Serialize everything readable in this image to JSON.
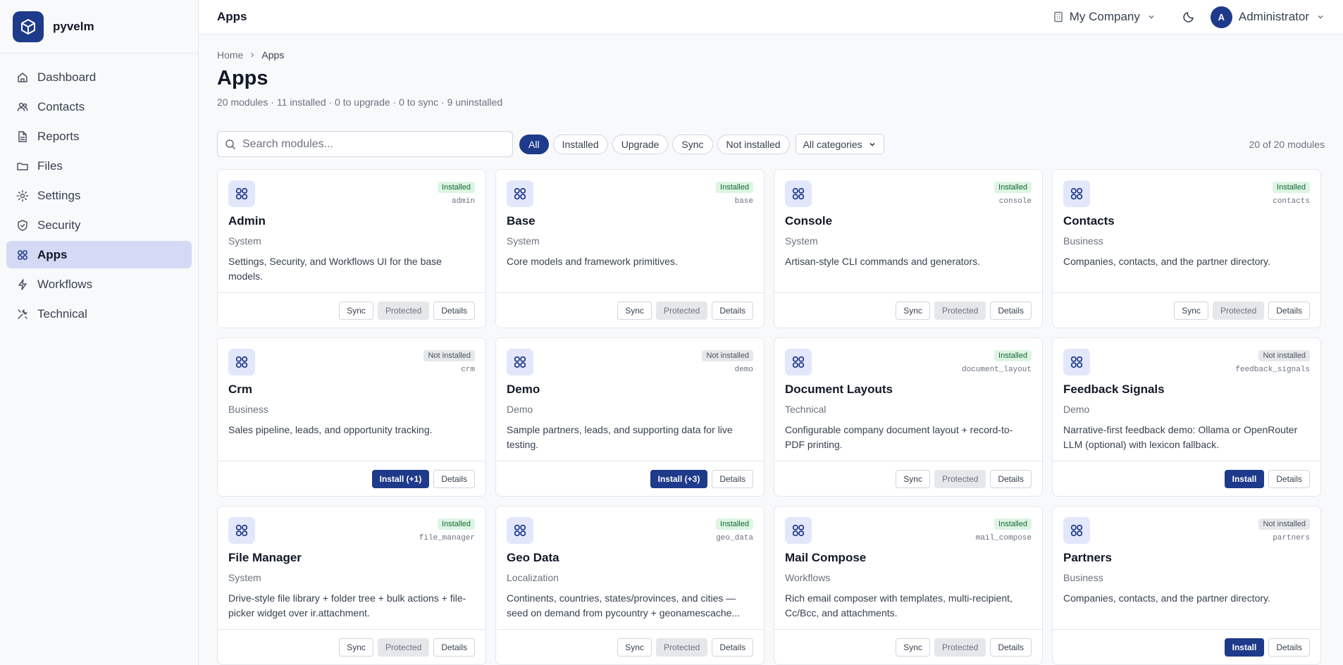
{
  "brand": {
    "name": "pyvelm"
  },
  "sidebar": {
    "items": [
      {
        "label": "Dashboard",
        "icon": "home-icon"
      },
      {
        "label": "Contacts",
        "icon": "users-icon"
      },
      {
        "label": "Reports",
        "icon": "file-icon"
      },
      {
        "label": "Files",
        "icon": "folder-icon"
      },
      {
        "label": "Settings",
        "icon": "gear-icon"
      },
      {
        "label": "Security",
        "icon": "shield-icon"
      },
      {
        "label": "Apps",
        "icon": "grid-icon",
        "active": true
      },
      {
        "label": "Workflows",
        "icon": "bolt-icon"
      },
      {
        "label": "Technical",
        "icon": "tools-icon"
      }
    ]
  },
  "topbar": {
    "title": "Apps",
    "company": "My Company",
    "avatar_initial": "A",
    "user": "Administrator"
  },
  "breadcrumb": {
    "home": "Home",
    "current": "Apps"
  },
  "page": {
    "title": "Apps",
    "subtitle": "20 modules · 11 installed · 0 to upgrade · 0 to sync · 9 uninstalled"
  },
  "filters": {
    "search_placeholder": "Search modules...",
    "pills": [
      "All",
      "Installed",
      "Upgrade",
      "Sync",
      "Not installed"
    ],
    "active_pill": "All",
    "category": "All categories",
    "count": "20 of 20 modules"
  },
  "modules": [
    {
      "name": "Admin",
      "tech": "admin",
      "status": "Installed",
      "category": "System",
      "description": "Settings, Security, and Workflows UI for the base models.",
      "actions": [
        "Sync",
        "Protected",
        "Details"
      ]
    },
    {
      "name": "Base",
      "tech": "base",
      "status": "Installed",
      "category": "System",
      "description": "Core models and framework primitives.",
      "actions": [
        "Sync",
        "Protected",
        "Details"
      ]
    },
    {
      "name": "Console",
      "tech": "console",
      "status": "Installed",
      "category": "System",
      "description": "Artisan-style CLI commands and generators.",
      "actions": [
        "Sync",
        "Protected",
        "Details"
      ]
    },
    {
      "name": "Contacts",
      "tech": "contacts",
      "status": "Installed",
      "category": "Business",
      "description": "Companies, contacts, and the partner directory.",
      "actions": [
        "Sync",
        "Protected",
        "Details"
      ]
    },
    {
      "name": "Crm",
      "tech": "crm",
      "status": "Not installed",
      "category": "Business",
      "description": "Sales pipeline, leads, and opportunity tracking.",
      "actions": [
        "Install (+1)",
        "Details"
      ]
    },
    {
      "name": "Demo",
      "tech": "demo",
      "status": "Not installed",
      "category": "Demo",
      "description": "Sample partners, leads, and supporting data for live testing.",
      "actions": [
        "Install (+3)",
        "Details"
      ]
    },
    {
      "name": "Document Layouts",
      "tech": "document_layout",
      "status": "Installed",
      "category": "Technical",
      "description": "Configurable company document layout + record-to-PDF printing.",
      "actions": [
        "Sync",
        "Protected",
        "Details"
      ]
    },
    {
      "name": "Feedback Signals",
      "tech": "feedback_signals",
      "status": "Not installed",
      "category": "Demo",
      "description": "Narrative-first feedback demo: Ollama or OpenRouter LLM (optional) with lexicon fallback.",
      "actions": [
        "Install",
        "Details"
      ]
    },
    {
      "name": "File Manager",
      "tech": "file_manager",
      "status": "Installed",
      "category": "System",
      "description": "Drive-style file library + folder tree + bulk actions + file-picker widget over ir.attachment.",
      "actions": [
        "Sync",
        "Protected",
        "Details"
      ]
    },
    {
      "name": "Geo Data",
      "tech": "geo_data",
      "status": "Installed",
      "category": "Localization",
      "description": "Continents, countries, states/provinces, and cities — seed on demand from pycountry + geonamescache...",
      "actions": [
        "Sync",
        "Protected",
        "Details"
      ]
    },
    {
      "name": "Mail Compose",
      "tech": "mail_compose",
      "status": "Installed",
      "category": "Workflows",
      "description": "Rich email composer with templates, multi-recipient, Cc/Bcc, and attachments.",
      "actions": [
        "Sync",
        "Protected",
        "Details"
      ]
    },
    {
      "name": "Partners",
      "tech": "partners",
      "status": "Not installed",
      "category": "Business",
      "description": "Companies, contacts, and the partner directory.",
      "actions": [
        "Install",
        "Details"
      ]
    }
  ]
}
